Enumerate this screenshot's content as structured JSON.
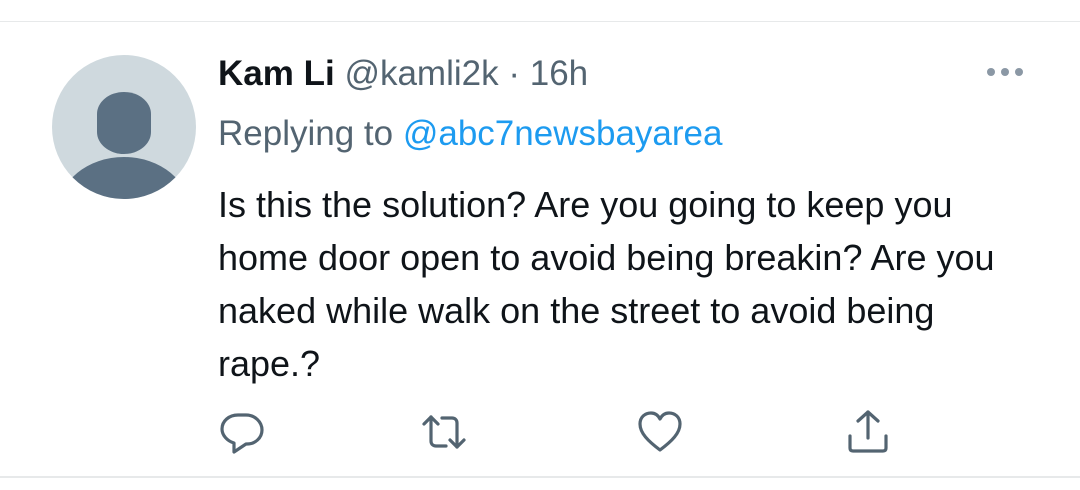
{
  "tweet": {
    "display_name": "Kam Li",
    "handle": "@kamli2k",
    "separator": "·",
    "time": "16h",
    "replying_prefix": "Replying to",
    "replying_to": "@abc7newsbayarea",
    "text": "Is this the solution? Are you going to keep you home door open to avoid being breakin? Are you naked while walk on the street to avoid being rape.?"
  },
  "icons": {
    "avatar": "default-avatar-icon",
    "more": "more-dots-icon",
    "reply": "reply-icon",
    "retweet": "retweet-icon",
    "like": "heart-icon",
    "share": "share-icon"
  },
  "colors": {
    "text": "#0f1419",
    "secondary": "#536471",
    "link": "#1d9bf0",
    "avatar_bg": "#cfd9de",
    "avatar_fg": "#5b7083"
  }
}
